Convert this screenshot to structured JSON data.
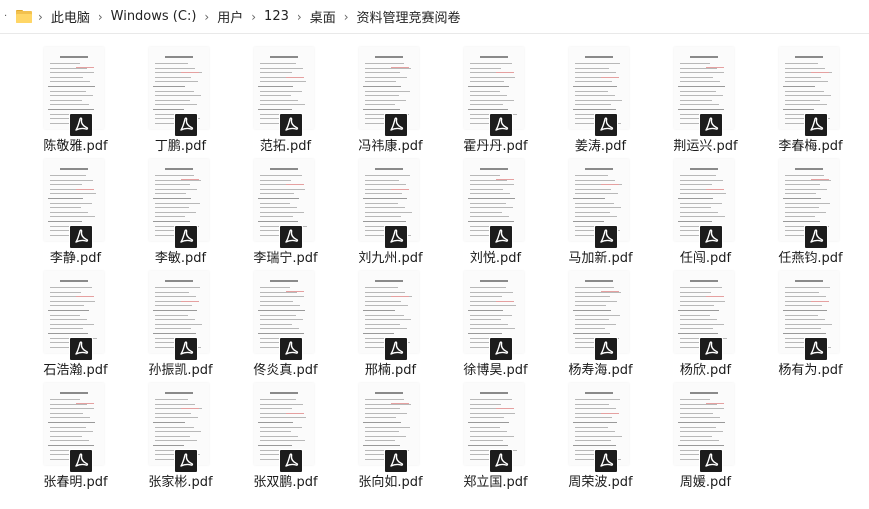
{
  "address_bar": {
    "crumbs": [
      "此电脑",
      "Windows (C:)",
      "用户",
      "123",
      "桌面",
      "资料管理竞赛阅卷"
    ]
  },
  "files": [
    {
      "name": "陈敬雅.pdf"
    },
    {
      "name": "丁鹏.pdf"
    },
    {
      "name": "范拓.pdf"
    },
    {
      "name": "冯祎康.pdf"
    },
    {
      "name": "霍丹丹.pdf"
    },
    {
      "name": "姜涛.pdf"
    },
    {
      "name": "荆运兴.pdf"
    },
    {
      "name": "李春梅.pdf"
    },
    {
      "name": "李静.pdf"
    },
    {
      "name": "李敏.pdf"
    },
    {
      "name": "李瑞宁.pdf"
    },
    {
      "name": "刘九州.pdf"
    },
    {
      "name": "刘悦.pdf"
    },
    {
      "name": "马加新.pdf"
    },
    {
      "name": "任闯.pdf"
    },
    {
      "name": "任燕钧.pdf"
    },
    {
      "name": "石浩瀚.pdf"
    },
    {
      "name": "孙振凯.pdf"
    },
    {
      "name": "佟炎真.pdf"
    },
    {
      "name": "邢楠.pdf"
    },
    {
      "name": "徐博昊.pdf"
    },
    {
      "name": "杨寿海.pdf"
    },
    {
      "name": "杨欣.pdf"
    },
    {
      "name": "杨有为.pdf"
    },
    {
      "name": "张春明.pdf"
    },
    {
      "name": "张家彬.pdf"
    },
    {
      "name": "张双鹏.pdf"
    },
    {
      "name": "张向如.pdf"
    },
    {
      "name": "郑立国.pdf"
    },
    {
      "name": "周荣波.pdf"
    },
    {
      "name": "周媛.pdf"
    }
  ],
  "icons": {
    "folder": "folder-icon",
    "file_badge": "pdf-icon"
  },
  "colors": {
    "folder": "#f2c14e",
    "badge": "#1c1c1c"
  }
}
